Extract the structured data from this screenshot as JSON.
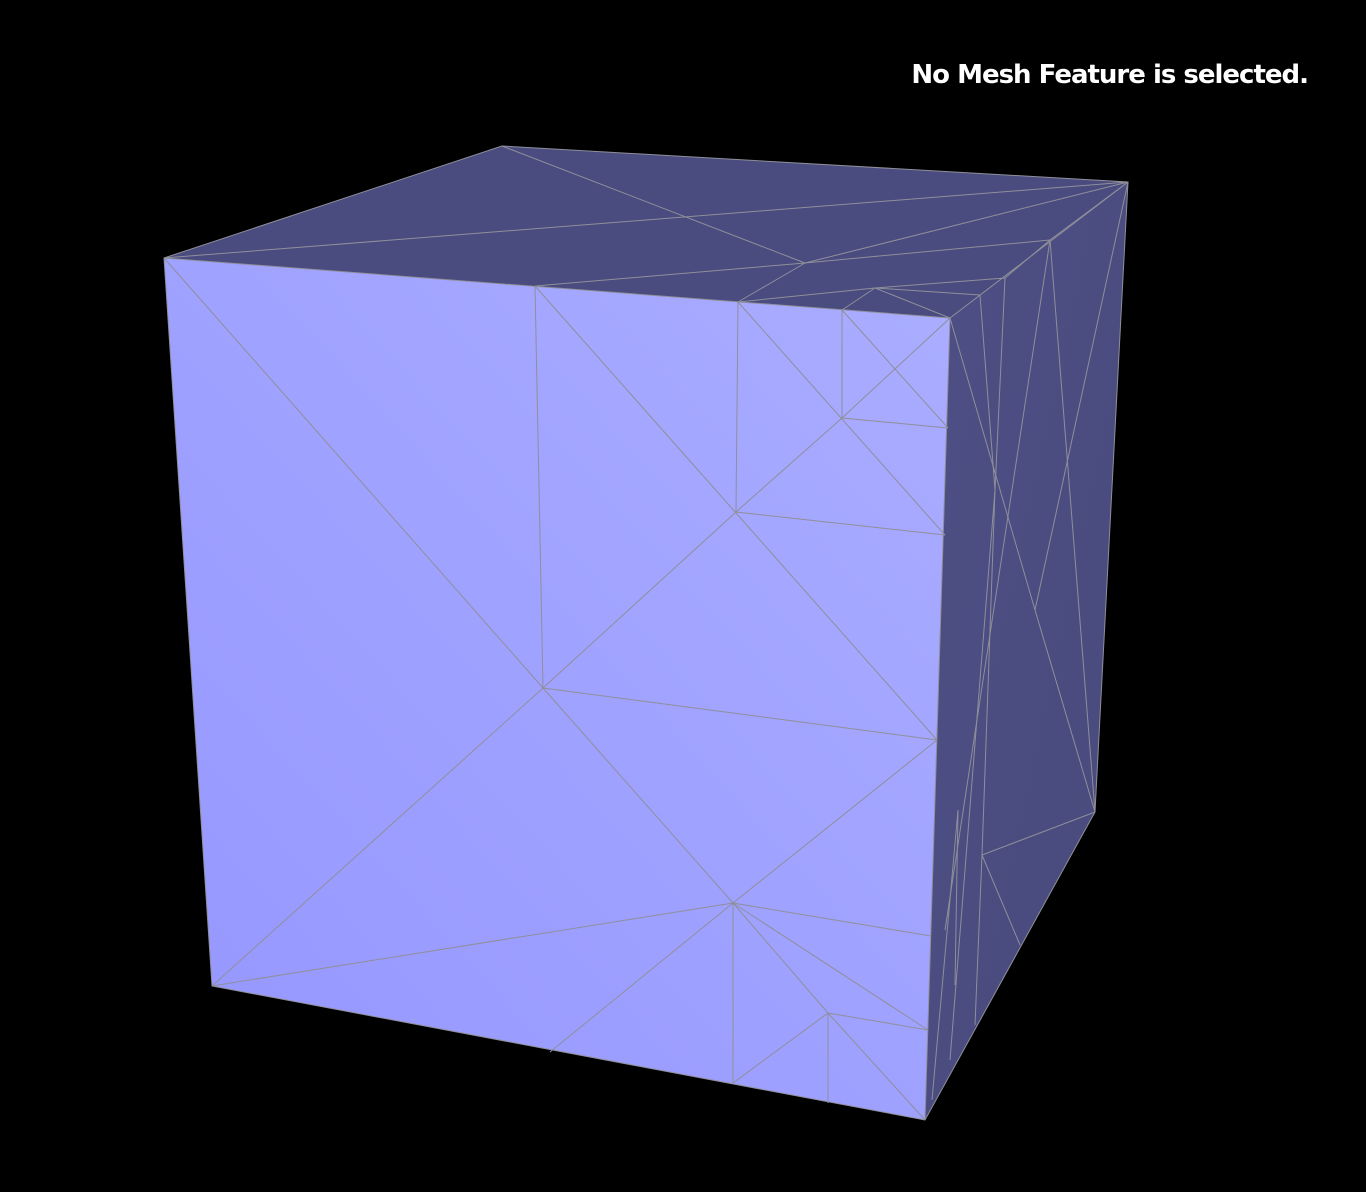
{
  "viewer": {
    "status_message": "No Mesh Feature is selected.",
    "background_color": "#000000",
    "mesh": {
      "shape": "cube",
      "render_mode": "shaded-with-wireframe",
      "front_face_color": "#a3a5ff",
      "side_face_color": "#4b4c80",
      "top_face_color": "#4a4b7f",
      "edge_color": "#8f8f9a"
    }
  }
}
